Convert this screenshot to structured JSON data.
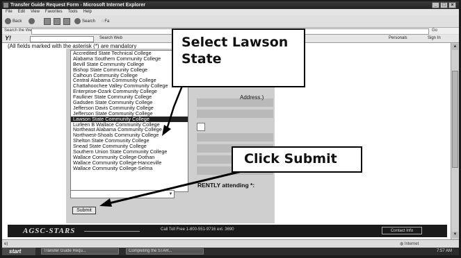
{
  "window": {
    "title": "Transfer Guide Request Form - Microsoft Internet Explorer",
    "menu": [
      "File",
      "Edit",
      "View",
      "Favorites",
      "Tools",
      "Help"
    ]
  },
  "toolbar": {
    "back": "Back",
    "search": "Search",
    "favorites": "Fa"
  },
  "address": {
    "label": "Search the Web"
  },
  "yahoo": {
    "logo": "Y!",
    "search_label": "Search Web",
    "personals": "Personals",
    "signin": "Sign In"
  },
  "page": {
    "instructions": "(All fields marked with the asterisk (*) are mandatory"
  },
  "form": {
    "colleges": [
      "Accredited State Technical College",
      "Alabama Southern Community College",
      "Bevill State Community College",
      "Bishop State Community College",
      "Calhoun Community College",
      "Central Alabama Community College",
      "Chattahoochee Valley Community College",
      "Enterprise-Ozark Community College",
      "Faulkner State Community College",
      "Gadsden State Community College",
      "Jefferson Davis Community College",
      "Jefferson State Community College",
      "Lawson State Community College",
      "Lurleen B Wallace Community College",
      "Northeast Alabama Community College",
      "Northwest-Shoals Community College",
      "Shelton State Community College",
      "Snead State Community College",
      "Southern Union State Community College",
      "Wallace Community College-Dothan",
      "Wallace Community College-Hanceville",
      "Wallace Community College-Selma"
    ],
    "selected_index": 12,
    "address_label": "Address.)",
    "attending_label": "RENTLY attending *:",
    "submit_label": "Submit"
  },
  "footer": {
    "logo": "AGSC-STARS",
    "phone_text": "Call Toll Free 1-800-551-9716 ext. 3690",
    "contact_button": "Contact Info"
  },
  "status": {
    "zone": "Internet"
  },
  "taskbar": {
    "start": "start",
    "tasks": [
      "Transfer Guide Requ...",
      "Completing the STAR..."
    ],
    "clock": "7:57 AM"
  },
  "callouts": {
    "select": "Select Lawson State",
    "submit": "Click Submit"
  }
}
